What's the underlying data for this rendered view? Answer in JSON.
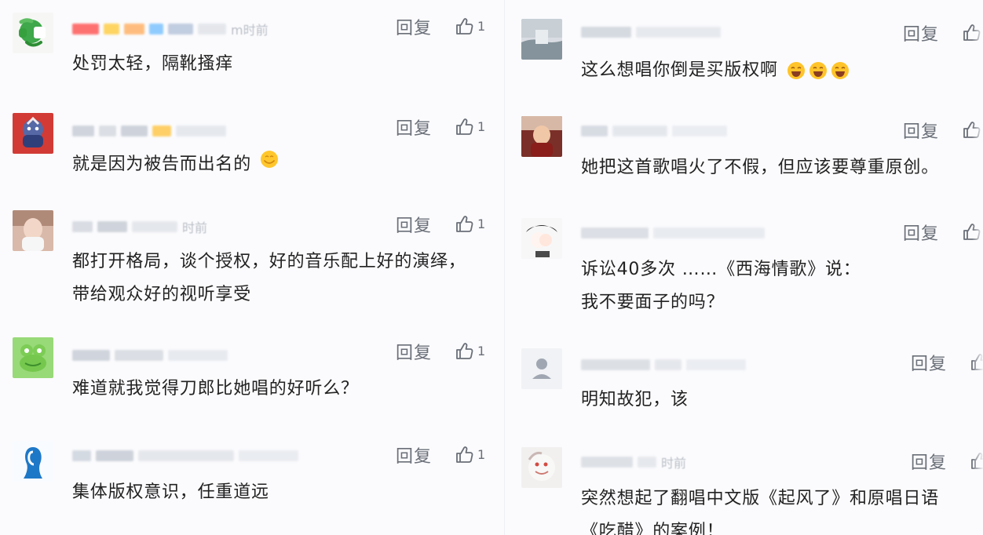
{
  "left_column": [
    {
      "text": "处罚太轻，隔靴搔痒",
      "reply_label": "回复",
      "like_count": "1",
      "meta_time": "m时前",
      "avatar": "green-cartoon-avatar"
    },
    {
      "text": "就是因为被告而出名的",
      "reply_label": "回复",
      "like_count": "1",
      "meta_time": "",
      "avatar": "red-character-avatar"
    },
    {
      "text": "都打开格局，谈个授权，好的音乐配上好的演绎，带给观众好的视听享受",
      "reply_label": "回复",
      "like_count": "1",
      "meta_time": "时前",
      "avatar": "portrait-avatar"
    },
    {
      "text": "难道就我觉得刀郎比她唱的好听么？",
      "reply_label": "回复",
      "like_count": "1",
      "meta_time": "",
      "avatar": "green-frog-avatar"
    },
    {
      "text": "集体版权意识，任重道远",
      "reply_label": "回复",
      "like_count": "1",
      "meta_time": "",
      "avatar": "blue-silhouette-avatar"
    }
  ],
  "right_column": [
    {
      "text": "这么想唱你倒是买版权啊",
      "reply_label": "回复",
      "avatar": "landscape-avatar"
    },
    {
      "text": "她把这首歌唱火了不假，但应该要尊重原创。",
      "reply_label": "回复",
      "avatar": "warm-portrait-avatar"
    },
    {
      "text": "诉讼40多次 ……《西海情歌》说：我不要面子的吗？",
      "reply_label": "回复",
      "avatar": "cartoon-face-avatar"
    },
    {
      "text": "明知故犯，该",
      "reply_label": "回复",
      "avatar": "default-user-avatar"
    },
    {
      "text": "突然想起了翻唱中文版《起风了》和原唱日语《吃醋》的案例！",
      "reply_label": "回复",
      "meta_time": "时前",
      "avatar": "light-illustration-avatar"
    }
  ],
  "colors": {
    "page_bg": "#fbfbfd",
    "text": "#222222",
    "secondary": "#6a6f78",
    "meta": "#aeb4bc"
  }
}
